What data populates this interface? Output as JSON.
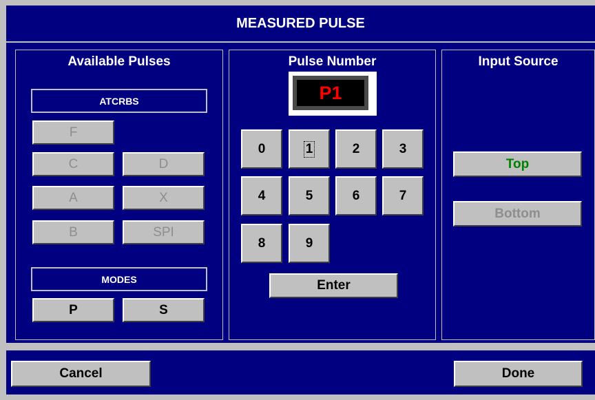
{
  "title": "MEASURED PULSE",
  "available_pulses": {
    "title": "Available Pulses",
    "atcrbs_label": "ATCRBS",
    "modes_label": "MODES",
    "buttons": {
      "F": "F",
      "C": "C",
      "D": "D",
      "A": "A",
      "X": "X",
      "B": "B",
      "SPI": "SPI",
      "P": "P",
      "S": "S"
    }
  },
  "pulse_number": {
    "title": "Pulse Number",
    "display": "P1",
    "keys": [
      "0",
      "1",
      "2",
      "3",
      "4",
      "5",
      "6",
      "7",
      "8",
      "9"
    ],
    "enter_label": "Enter"
  },
  "input_source": {
    "title": "Input Source",
    "top_label": "Top",
    "bottom_label": "Bottom"
  },
  "footer": {
    "cancel_label": "Cancel",
    "done_label": "Done"
  },
  "colors": {
    "background": "#000080",
    "frame": "#c0c0c0",
    "display_text": "#ff0000",
    "active_source": "#008000",
    "disabled_text": "#8e8e8e"
  }
}
